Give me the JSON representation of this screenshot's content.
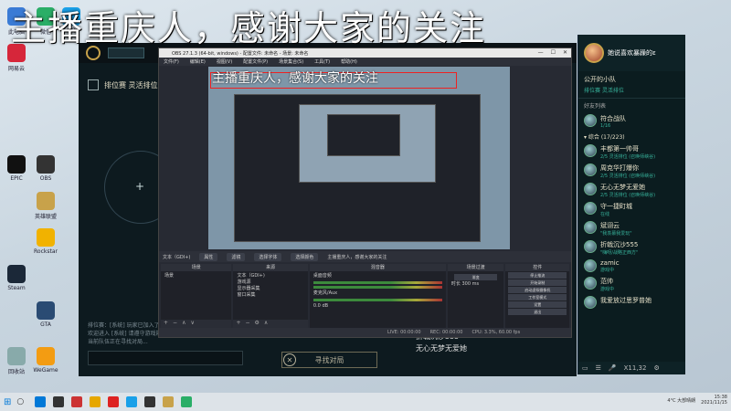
{
  "stream_title": "主播重庆人，感谢大家的关注",
  "desktop_icons": [
    {
      "label": "此电脑",
      "color": "#3a7bd5"
    },
    {
      "label": "微信",
      "color": "#2aae67"
    },
    {
      "label": "QQ",
      "color": "#1aa0e8"
    },
    {
      "label": "网易云",
      "color": "#d6263a"
    },
    {
      "label": "EPIC",
      "color": "#111111"
    },
    {
      "label": "OBS",
      "color": "#333333"
    },
    {
      "label": "英雄联盟",
      "color": "#c8a24a"
    },
    {
      "label": "Rockstar",
      "color": "#f1b200"
    },
    {
      "label": "Steam",
      "color": "#1b2838"
    },
    {
      "label": "GTA",
      "color": "#2a4b73"
    },
    {
      "label": "回收站",
      "color": "#8aa"
    },
    {
      "label": "WeGame",
      "color": "#f39c12"
    }
  ],
  "lol": {
    "mode_label": "排位赛 灵活排位",
    "find_match": "寻找对局",
    "chat_lines": [
      "排位赛：[系统] 玩家已加入了队伍",
      "欢迎进入 [系统] 请遵守游戏规范",
      "当前队伍正在寻找对局..."
    ]
  },
  "under_friends": [
    "折戟沉沙555",
    "无心无梦无爱她"
  ],
  "obs": {
    "title": "OBS 27.1.3 (64-bit, windows) - 配置文件: 未命名 - 场景: 未命名",
    "menu": [
      "文件(F)",
      "编辑(E)",
      "视图(V)",
      "配置文件(P)",
      "场景集合(S)",
      "工具(T)",
      "帮助(H)"
    ],
    "preview_title": "主播重庆人，感谢大家的关注",
    "toolbar": [
      "文本（GDI+)",
      "属性",
      "滤镜",
      "选择字体",
      "选择颜色",
      "主播重庆人，感谢大家的关注"
    ],
    "docks": {
      "scenes": {
        "header": "场景",
        "items": [
          "场景"
        ]
      },
      "sources": {
        "header": "来源",
        "items": [
          "文本（GDI+)",
          "游戏源",
          "显示器采集",
          "窗口采集"
        ]
      },
      "mixer": {
        "header": "混音器",
        "tracks": [
          "桌面音频",
          "麦克风/Aux"
        ],
        "level": "0.0 dB"
      },
      "transitions": {
        "header": "场景过渡",
        "type": "渐变",
        "duration_label": "时长",
        "duration": "300 ms"
      },
      "controls": {
        "header": "控件",
        "buttons": [
          "停止推流",
          "开始录制",
          "启动虚拟摄像机",
          "工作室模式",
          "设置",
          "退出"
        ]
      }
    },
    "status": [
      "LIVE: 00:00:00",
      "REC: 00:00:00",
      "CPU: 3.3%, 60.00 fps"
    ]
  },
  "friends": {
    "user": "她说喜欢暴躁的ε",
    "group_header": "公开的小队",
    "group_status": "排位赛 灵活排位",
    "list_header": "好友列表",
    "team": {
      "name": "符合战队",
      "sub": "1/16"
    },
    "category": "▾ 综合 (17/223)",
    "items": [
      {
        "name": "丰都第一帅哥",
        "status": "2/5 灵活排位 (召唤师峡谷)"
      },
      {
        "name": "周克华打爆你",
        "status": "2/5 灵活排位 (召唤师峡谷)"
      },
      {
        "name": "无心无梦无爱她",
        "status": "2/5 灵活排位 (召唤师峡谷)"
      },
      {
        "name": "守一捷町城",
        "status": "在线"
      },
      {
        "name": "斌诩云",
        "status": "\"我羡慕我爱玩\""
      },
      {
        "name": "折戟沉沙555",
        "status": "\"嗨呀/战略正西方\""
      },
      {
        "name": "zamic",
        "status": "游戏中"
      },
      {
        "name": "范帅",
        "status": "游戏中"
      },
      {
        "name": "我爱放过思罗普她",
        "status": ""
      }
    ],
    "bottom_count": "X11,32"
  },
  "taskbar": {
    "icons": [
      "#0078d7",
      "#333",
      "#c33",
      "#e6a700",
      "#d22",
      "#1aa0e8",
      "#333",
      "#c8a24a",
      "#2aae67"
    ],
    "weather": "4°C 大部晴朗",
    "time": "15:38",
    "date": "2021/11/15"
  }
}
